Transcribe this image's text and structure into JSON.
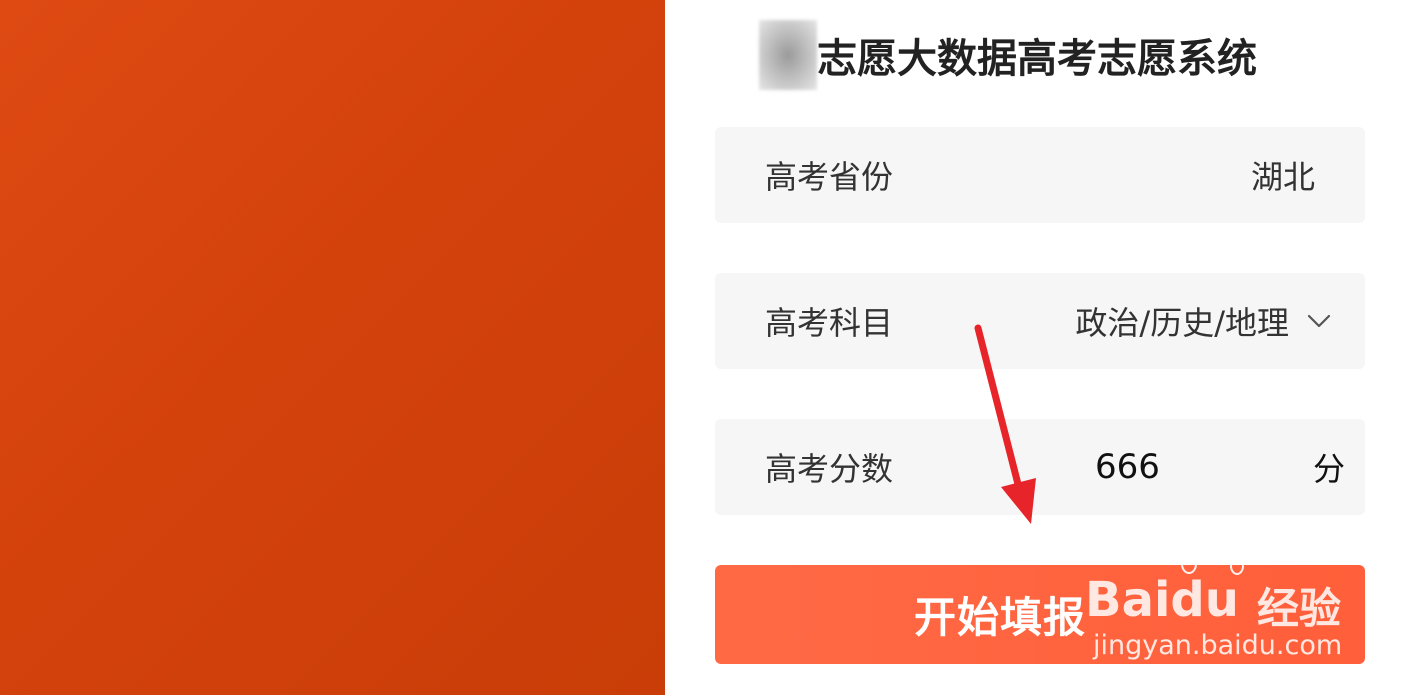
{
  "header": {
    "title": "志愿大数据高考志愿系统"
  },
  "form": {
    "province": {
      "label": "高考省份",
      "value": "湖北"
    },
    "subject": {
      "label": "高考科目",
      "value": "政治/历史/地理",
      "icon": "chevron-down-icon"
    },
    "score": {
      "label": "高考分数",
      "value": "666",
      "unit": "分"
    }
  },
  "submit": {
    "label": "开始填报"
  },
  "annotation": {
    "arrow_color": "#e8242b"
  },
  "watermark": {
    "brand": "Baidu",
    "product": "经验",
    "url": "jingyan.baidu.com"
  },
  "colors": {
    "left_background": "#d4420c",
    "button": "#ff6545",
    "field_background": "#f6f6f6"
  }
}
